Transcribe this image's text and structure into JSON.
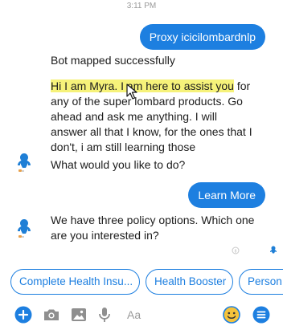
{
  "status": {
    "time": "3:11 PM"
  },
  "messages": {
    "user_1": "Proxy icicilombardnlp",
    "bot_mapped": "Bot mapped successfully",
    "bot_intro_highlight": "Hi I am Myra. I am here to assist you",
    "bot_intro_line1_rest": " for",
    "bot_intro_line2": "any of the super lombard products. Go",
    "bot_intro_line3": "ahead and ask me anything. I will",
    "bot_intro_line4": "answer all that I know, for the ones that I",
    "bot_intro_line5": "don't, i am still learning those",
    "bot_question": "What would you like to do?",
    "user_2": "Learn More",
    "bot_policy_line1": "We have three policy options. Which one",
    "bot_policy_line2": "are you interested in?"
  },
  "quick_replies": [
    "Complete Health Insu...",
    "Health Booster",
    "Person"
  ],
  "composer": {
    "placeholder": "Aa"
  },
  "colors": {
    "accent": "#1d7fe0",
    "highlight": "#f6f27a",
    "avatar": "#1f7fd6"
  },
  "icons": {
    "toolbar": [
      "plus-icon",
      "camera-icon",
      "image-icon",
      "microphone-icon",
      "emoji-icon",
      "menu-icon"
    ],
    "avatar": "bot-avatar-icon"
  }
}
